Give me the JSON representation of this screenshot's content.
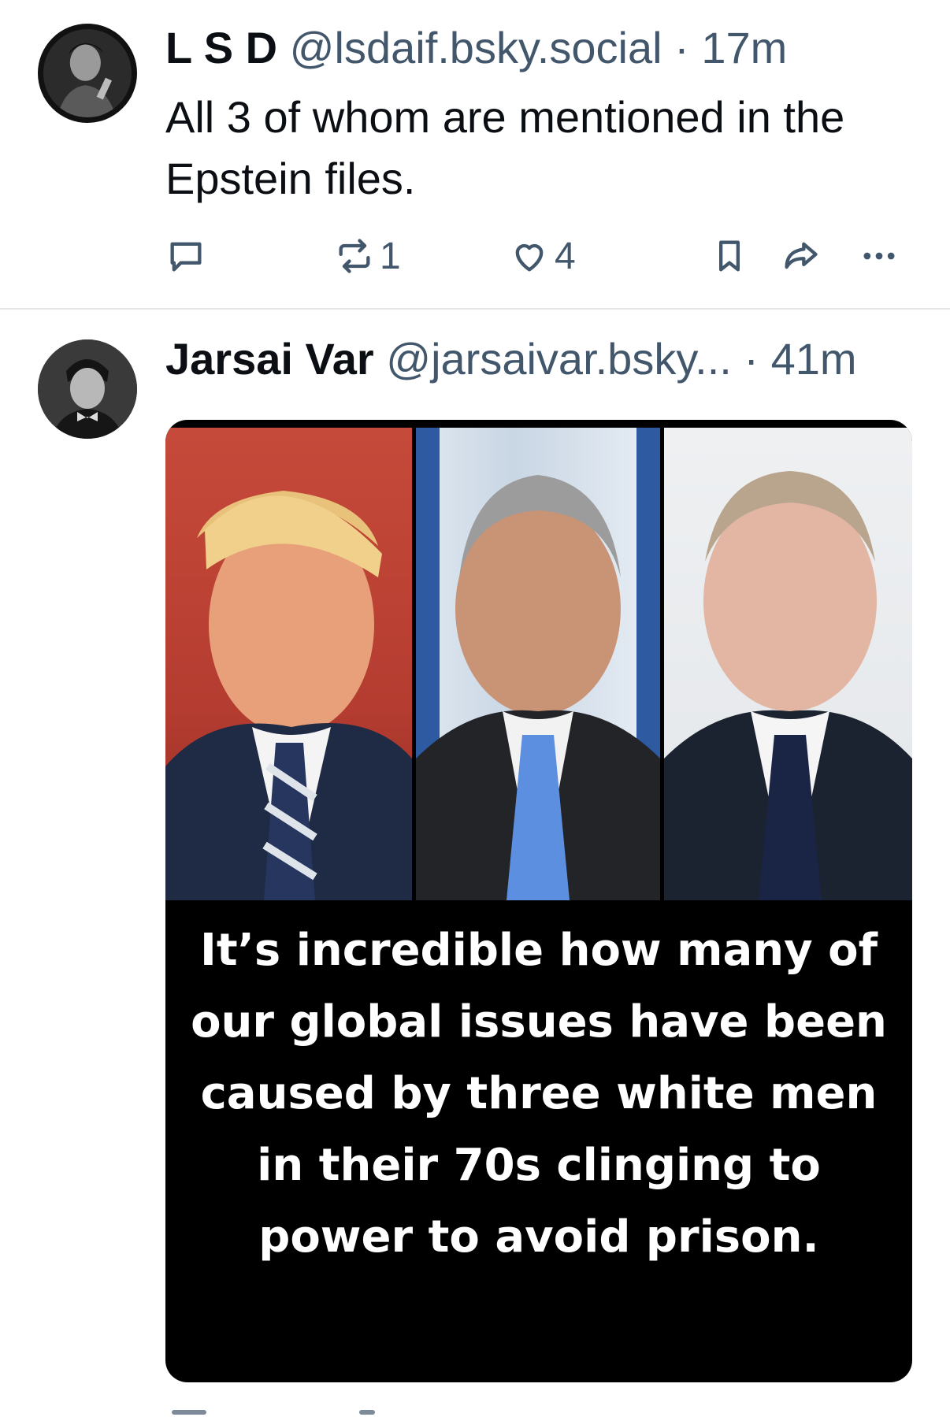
{
  "posts": [
    {
      "author_name": "L S D",
      "handle": "@lsdaif.bsky.social",
      "separator": "·",
      "time": "17m",
      "text": "All 3 of whom are mentioned in the Epstein files.",
      "reposts": "1",
      "likes": "4",
      "icons": [
        "reply-icon",
        "repost-icon",
        "heart-icon",
        "bookmark-icon",
        "share-icon",
        "more-icon"
      ]
    },
    {
      "author_name": "Jarsai Var",
      "handle": "@jarsaivar.bsky...",
      "separator": "·",
      "time": "41m",
      "image_caption": "It’s incredible how many of our global issues have been caused by three white men in their 70s clinging to power to avoid prison."
    }
  ],
  "colors": {
    "text_primary": "#0b0f14",
    "text_secondary": "#42576c",
    "divider": "#e3e6ea",
    "media_background": "#000000"
  }
}
